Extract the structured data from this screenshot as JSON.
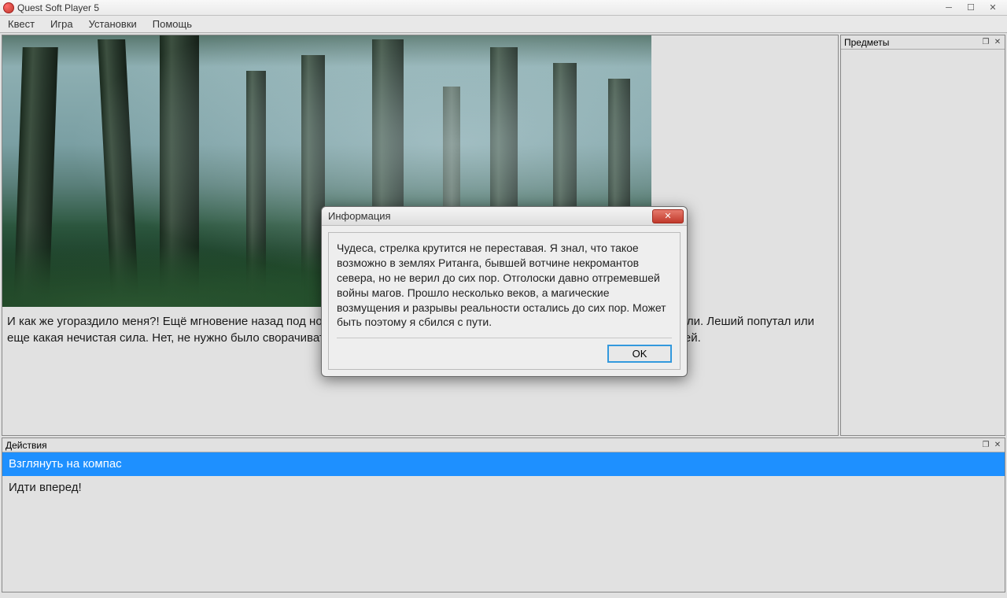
{
  "window": {
    "title": "Quest Soft Player 5"
  },
  "menu": {
    "items": [
      "Квест",
      "Игра",
      "Установки",
      "Помощь"
    ]
  },
  "story": {
    "text": "И как же угораздило меня?! Ещё мгновение назад под ногами был ровный, укатанный тракт и вдруг – мраки и густые заросли. Леший попутал или еще какая нечистая сила. Нет, не нужно было сворачивать в лес, нужно было двигаться по тракту и не искать коротких путей."
  },
  "side": {
    "title": "Предметы"
  },
  "actions": {
    "title": "Действия",
    "items": [
      {
        "label": "Взглянуть на компас",
        "selected": true
      },
      {
        "label": "Идти вперед!",
        "selected": false
      }
    ]
  },
  "modal": {
    "title": "Информация",
    "text": "Чудеса, стрелка крутится не переставая. Я знал, что такое возможно в землях Ританга, бывшей вотчине некромантов севера, но не верил до сих пор. Отголоски давно отгремевшей войны магов. Прошло несколько веков, а магические возмущения и разрывы реальности остались до сих пор. Может быть поэтому я сбился с пути.",
    "ok": "OK"
  }
}
